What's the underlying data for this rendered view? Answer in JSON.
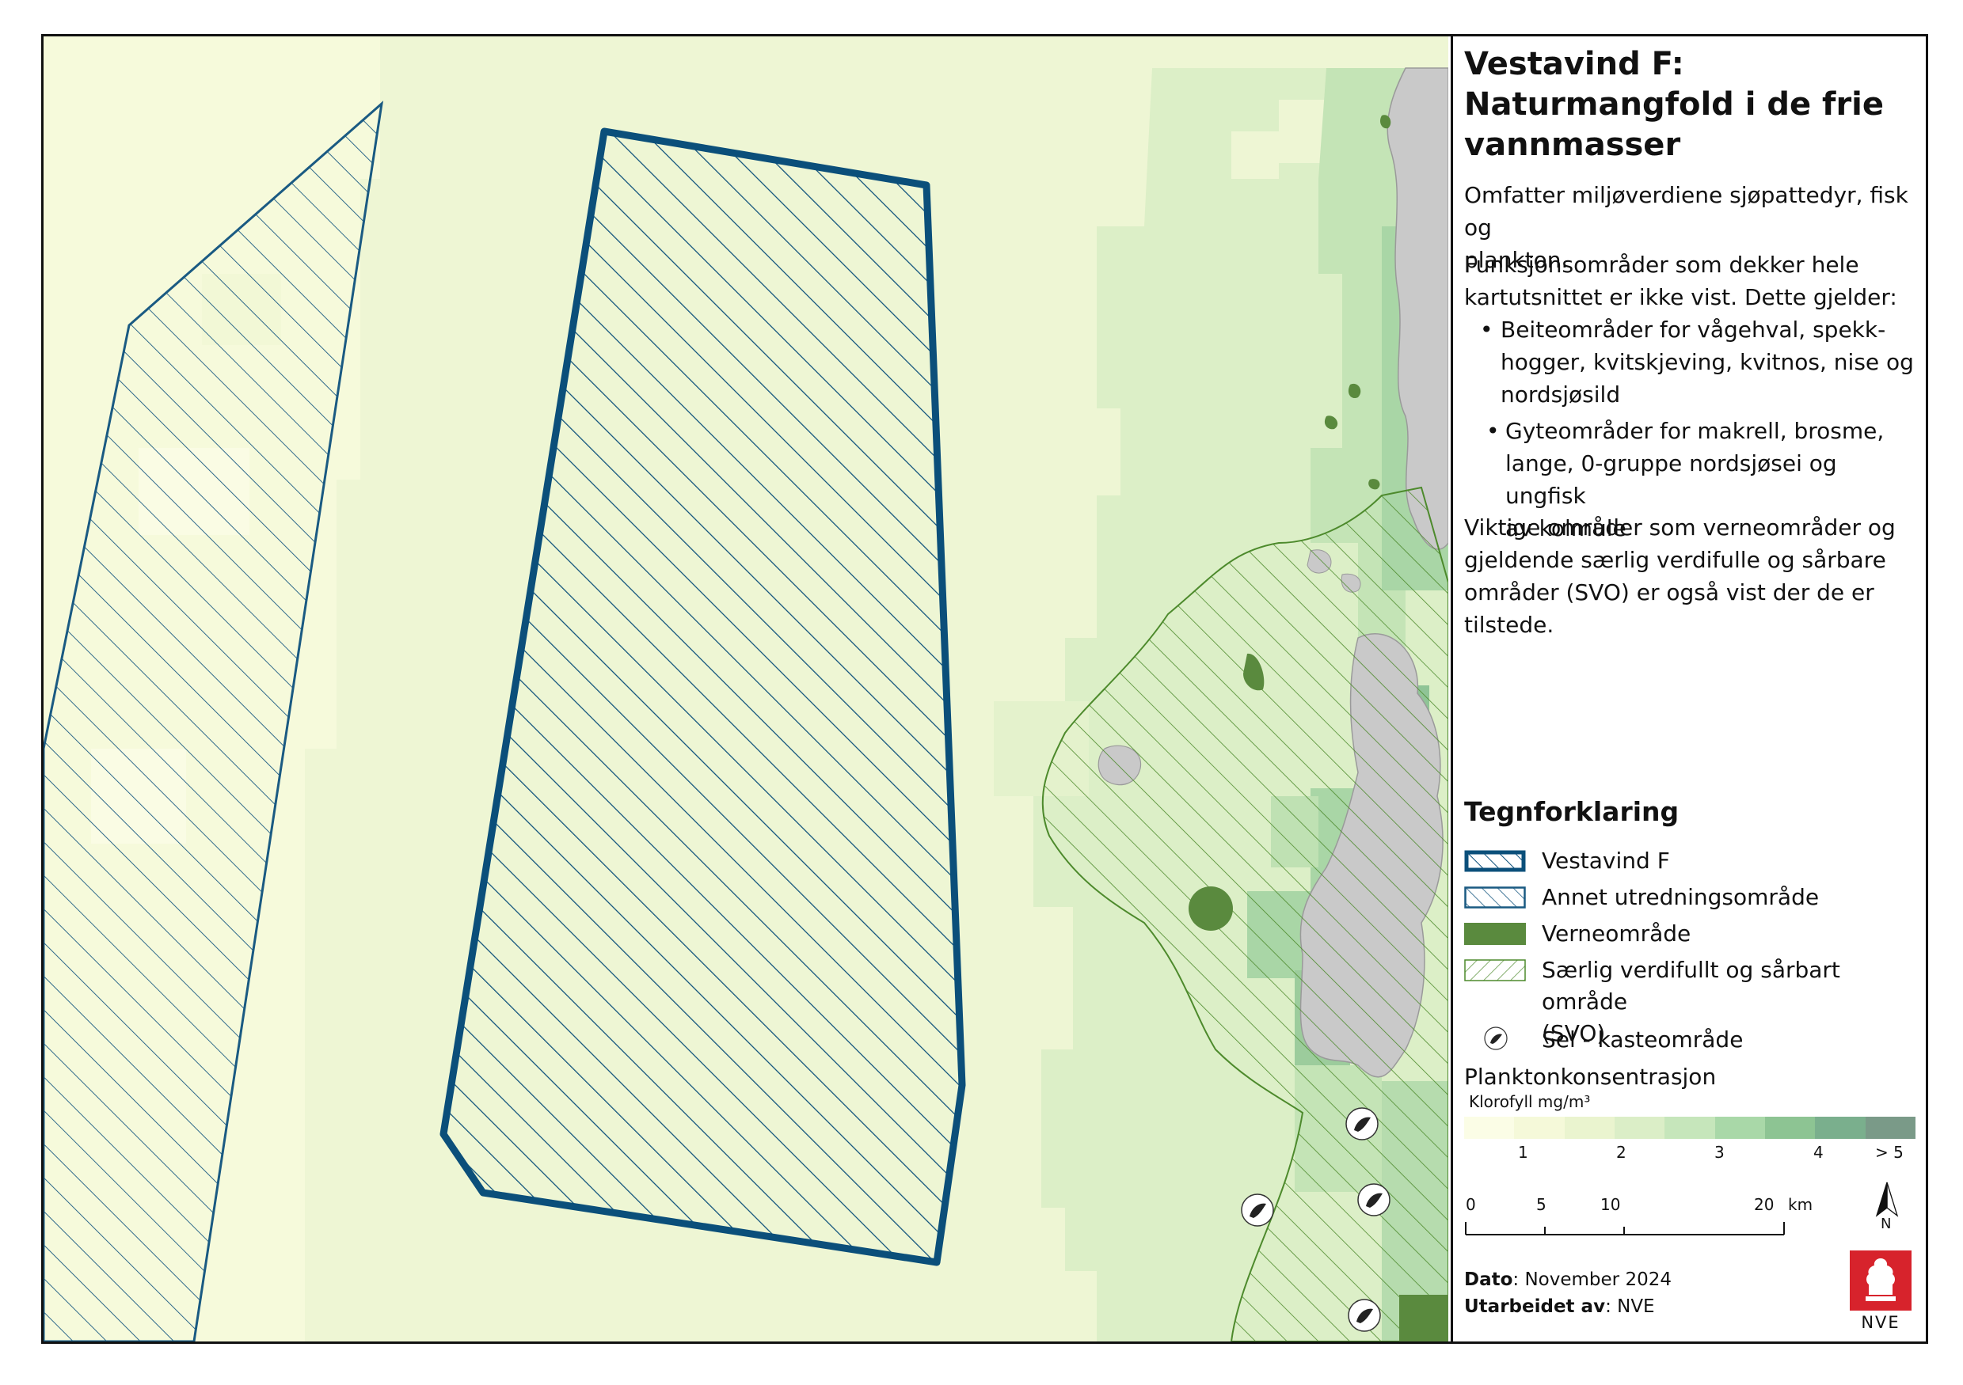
{
  "panel": {
    "title_lines": [
      "Vestavind F:",
      "Naturmangfold i de frie",
      "vannmasser"
    ],
    "intro_lines": [
      "Omfatter miljøverdiene sjøpattedyr, fisk og",
      "plankton."
    ],
    "func_lines": [
      "Funksjonsområder som dekker hele",
      "kartutsnittet er ikke vist. Dette gjelder:"
    ],
    "bullet1_lines": [
      "Beiteområder for vågehval, spekk-",
      "hogger, kvitskjeving, kvitnos, nise og",
      "nordsjøsild"
    ],
    "bullet2_lines": [
      "Gyteområder for makrell, brosme,",
      "lange, 0-gruppe nordsjøsei og ungfisk",
      "av kolmule"
    ],
    "important_lines": [
      "Viktige områder som verneområder og",
      "gjeldende særlig verdifulle og sårbare",
      "områder (SVO) er også vist der de er",
      "tilstede."
    ]
  },
  "legend": {
    "heading": "Tegnforklaring",
    "items": [
      {
        "label": "Vestavind F"
      },
      {
        "label": "Annet utredningsområde"
      },
      {
        "label": "Verneområde"
      },
      {
        "label": "Særlig verdifullt og sårbart område",
        "label2": "(SVO)"
      },
      {
        "label": "Sel - kasteområde"
      }
    ],
    "plankton_title": "Planktonkonsentrasjon",
    "plankton_unit": "Klorofyll mg/m³",
    "ramp_colors": [
      "#fbfde6",
      "#f5f9d9",
      "#eaf4cf",
      "#dbeec7",
      "#c6e6bb",
      "#a9d8a8",
      "#8dc493",
      "#7aaf8d",
      "#7a9a88"
    ],
    "ramp_labels": [
      "1",
      "2",
      "3",
      "4",
      "> 5"
    ]
  },
  "scale": {
    "ticks": [
      "0",
      "5",
      "10",
      "20"
    ],
    "unit": "km",
    "north": "N"
  },
  "footer": {
    "date_label": "Dato",
    "date_value": ": November 2024",
    "author_label": "Utarbeidet av",
    "author_value": ": NVE",
    "logo_text": "NVE"
  },
  "colors": {
    "vestavind": "#0b4f7a",
    "other_area": "#1a5a82",
    "verneomrade": "#5a8a3e",
    "svo": "#4d8a2c",
    "sea_base": "#eef6d4",
    "land": "#c9c9c9",
    "logo_red": "#d7232c"
  }
}
